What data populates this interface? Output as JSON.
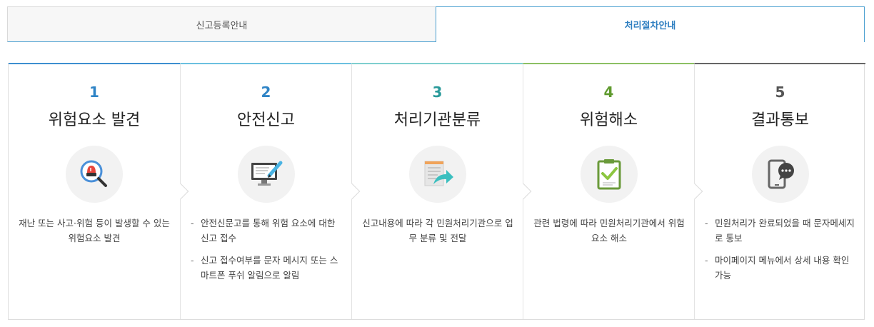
{
  "tabs": [
    {
      "label": "신고등록안내",
      "active": false
    },
    {
      "label": "처리절차안내",
      "active": true
    }
  ],
  "colors": {
    "active_tab": "#2f7fc1",
    "step1": "#3d8fd0",
    "step2": "#6bc0e0",
    "step3": "#7fcfcf",
    "step4": "#8cc063",
    "step5": "#666666"
  },
  "steps": [
    {
      "number": "1",
      "title": "위험요소 발견",
      "icon": "siren-magnifier-icon",
      "description": "재난 또는 사고·위험 등이 발생할 수 있는 위험요소 발견"
    },
    {
      "number": "2",
      "title": "안전신고",
      "icon": "monitor-pen-icon",
      "items": [
        "안전신문고를 통해 위험 요소에 대한 신고 접수",
        "신고 접수여부를 문자 메시지 또는 스마트폰 푸쉬 알림으로 알림"
      ]
    },
    {
      "number": "3",
      "title": "처리기관분류",
      "icon": "document-forward-icon",
      "description": "신고내용에 따라 각 민원처리기관으로 업무 분류 및 전달"
    },
    {
      "number": "4",
      "title": "위험해소",
      "icon": "clipboard-check-icon",
      "description": "관련 법령에 따라 민원처리기관에서 위험요소 해소"
    },
    {
      "number": "5",
      "title": "결과통보",
      "icon": "phone-chat-icon",
      "items": [
        "민원처리가 완료되었을 때 문자메세지로 통보",
        "마이페이지 메뉴에서 상세 내용 확인 가능"
      ]
    }
  ]
}
